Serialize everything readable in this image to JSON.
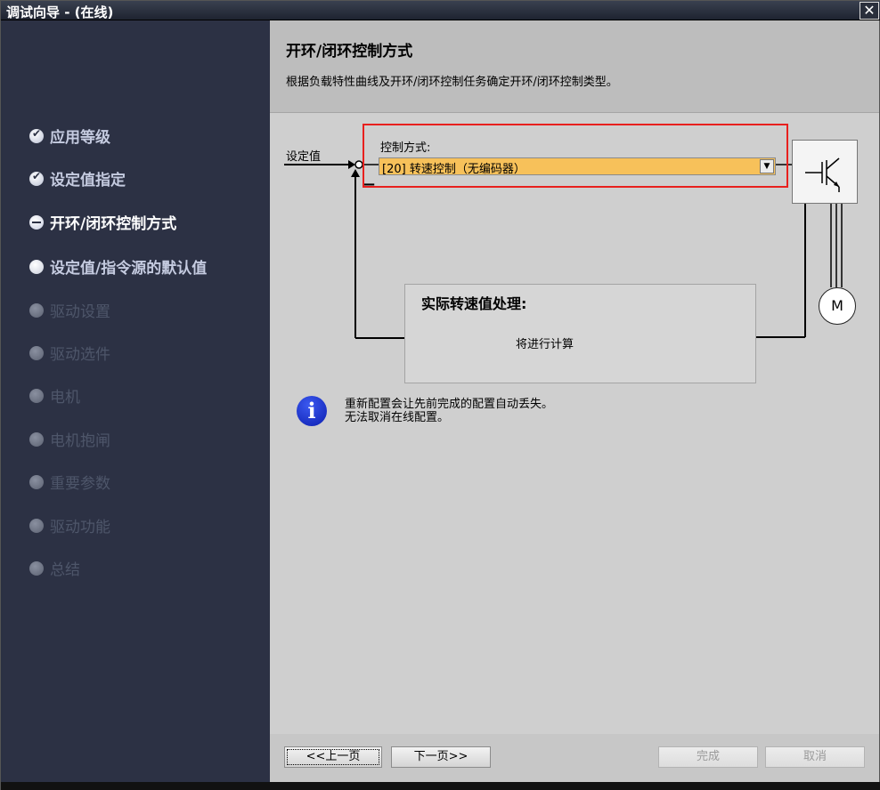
{
  "window": {
    "title": "调试向导 - (在线)",
    "close_glyph": "✕"
  },
  "sidebar": {
    "steps": [
      {
        "label": "应用等级",
        "state": "done"
      },
      {
        "label": "设定值指定",
        "state": "done"
      },
      {
        "label": "开环/闭环控制方式",
        "state": "current"
      },
      {
        "label": "设定值/指令源的默认值",
        "state": "pending"
      },
      {
        "label": "驱动设置",
        "state": "disabled"
      },
      {
        "label": "驱动选件",
        "state": "disabled"
      },
      {
        "label": "电机",
        "state": "disabled"
      },
      {
        "label": "电机抱闸",
        "state": "disabled"
      },
      {
        "label": "重要参数",
        "state": "disabled"
      },
      {
        "label": "驱动功能",
        "state": "disabled"
      },
      {
        "label": "总结",
        "state": "disabled"
      }
    ]
  },
  "header": {
    "title": "开环/闭环控制方式",
    "description": "根据负载特性曲线及开环/闭环控制任务确定开环/闭环控制类型。"
  },
  "diagram": {
    "setpoint_label": "设定值",
    "control_mode_label": "控制方式:",
    "control_mode_value": "[20] 转速控制（无编码器）",
    "feedback_title": "实际转速值处理:",
    "feedback_note": "将进行计算",
    "motor_label": "M",
    "minus_sign": "−"
  },
  "info": {
    "icon": "info-icon",
    "line1": "重新配置会让先前完成的配置自动丢失。",
    "line2": "无法取消在线配置。"
  },
  "footer": {
    "prev_label": "<<上一页",
    "next_label": "下一页>>",
    "finish_label": "完成",
    "cancel_label": "取消"
  },
  "colors": {
    "dropdown_bg": "#f7c15a",
    "highlight": "#e8201e",
    "sidebar_bg": "#2c3144"
  }
}
